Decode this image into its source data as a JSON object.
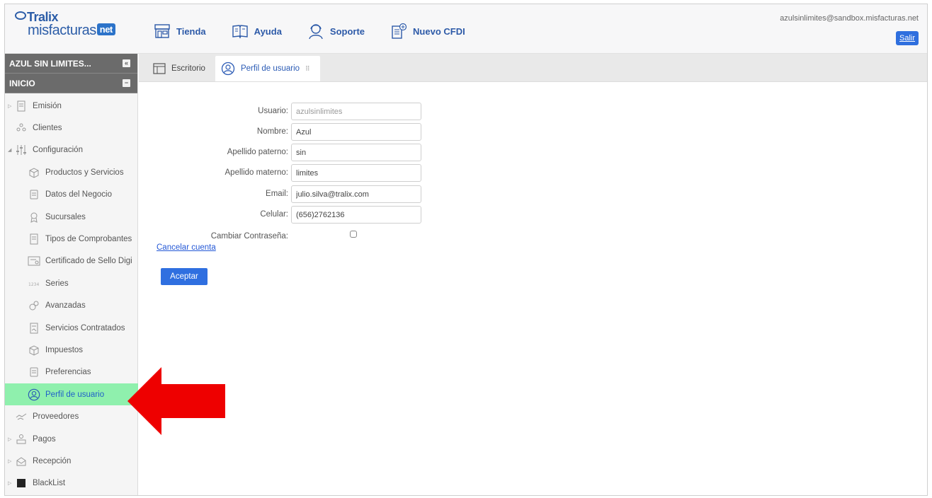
{
  "brand": {
    "logo_top": "Tralix",
    "logo_bottom": "misfacturas",
    "logo_badge": "net"
  },
  "nav": [
    {
      "label": "Tienda",
      "icon": "store-icon"
    },
    {
      "label": "Ayuda",
      "icon": "book-icon"
    },
    {
      "label": "Soporte",
      "icon": "support-agent-icon"
    },
    {
      "label": "Nuevo CFDI",
      "icon": "new-document-icon"
    }
  ],
  "account": {
    "email": "azulsinlimites@sandbox.misfacturas.net",
    "logout": "Salir"
  },
  "sidebar": {
    "company": "AZUL SIN LIMITES...",
    "section": "INICIO",
    "items": [
      {
        "label": "Emisión",
        "level": 0,
        "icon": "document-icon",
        "arrow": "▷"
      },
      {
        "label": "Clientes",
        "level": 0,
        "icon": "people-icon",
        "arrow": ""
      },
      {
        "label": "Configuración",
        "level": 0,
        "icon": "sliders-icon",
        "arrow": "◢"
      },
      {
        "label": "Productos y Servicios",
        "level": 1,
        "icon": "box-icon"
      },
      {
        "label": "Datos del Negocio",
        "level": 1,
        "icon": "notepad-icon"
      },
      {
        "label": "Sucursales",
        "level": 1,
        "icon": "badge-icon"
      },
      {
        "label": "Tipos de Comprobantes",
        "level": 1,
        "icon": "document-icon"
      },
      {
        "label": "Certificado de Sello Digi",
        "level": 1,
        "icon": "certificate-icon"
      },
      {
        "label": "Series",
        "level": 1,
        "icon": "series-icon"
      },
      {
        "label": "Avanzadas",
        "level": 1,
        "icon": "gears-icon"
      },
      {
        "label": "Servicios Contratados",
        "level": 1,
        "icon": "contract-icon"
      },
      {
        "label": "Impuestos",
        "level": 1,
        "icon": "box-icon"
      },
      {
        "label": "Preferencias",
        "level": 1,
        "icon": "notepad-icon"
      },
      {
        "label": "Perfil de usuario",
        "level": 1,
        "icon": "user-circle-icon",
        "active": true
      },
      {
        "label": "Proveedores",
        "level": 0,
        "icon": "handshake-icon",
        "arrow": ""
      },
      {
        "label": "Pagos",
        "level": 0,
        "icon": "payments-icon",
        "arrow": "▷"
      },
      {
        "label": "Recepción",
        "level": 0,
        "icon": "inbox-icon",
        "arrow": "▷"
      },
      {
        "label": "BlackList",
        "level": 0,
        "icon": "blacklist-icon",
        "arrow": "▷"
      }
    ]
  },
  "tabs": [
    {
      "label": "Escritorio",
      "icon": "desktop-icon",
      "active": false
    },
    {
      "label": "Perfil de usuario",
      "icon": "user-circle-icon",
      "active": true
    }
  ],
  "form": {
    "usuario": {
      "label": "Usuario:",
      "value": "azulsinlimites"
    },
    "nombre": {
      "label": "Nombre:",
      "value": "Azul"
    },
    "apellido_paterno": {
      "label": "Apellido paterno:",
      "value": "sin"
    },
    "apellido_materno": {
      "label": "Apellido materno:",
      "value": "limites"
    },
    "email": {
      "label": "Email:",
      "value": "julio.silva@tralix.com"
    },
    "celular": {
      "label": "Celular:",
      "value": "(656)2762136"
    },
    "cambiar": {
      "label": "Cambiar Contraseña:",
      "checked": false
    },
    "cancel_link": "Cancelar cuenta",
    "submit": "Aceptar"
  },
  "colors": {
    "accent": "#2f6fe0",
    "active_item": "#8ff0ad",
    "arrow": "#ee0000",
    "sidebar_head": "#6b6b6b"
  }
}
